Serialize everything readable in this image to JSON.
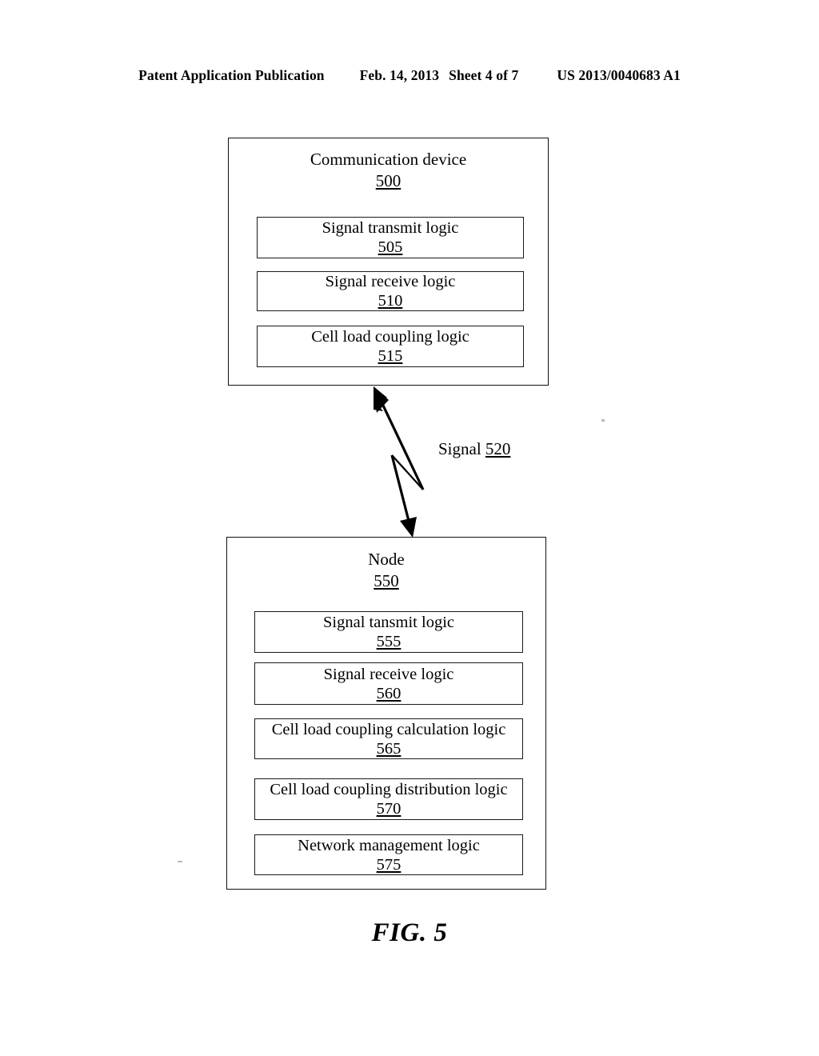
{
  "header": {
    "left": "Patent Application Publication",
    "date": "Feb. 14, 2013",
    "sheet": "Sheet 4 of 7",
    "publication_number": "US 2013/0040683 A1"
  },
  "figure": {
    "caption": "FIG. 5",
    "signal": {
      "label": "Signal",
      "ref": "520"
    },
    "blocks": [
      {
        "title": "Communication device",
        "ref": "500",
        "components": [
          {
            "label": "Signal transmit logic",
            "ref": "505"
          },
          {
            "label": "Signal receive logic",
            "ref": "510"
          },
          {
            "label": "Cell load coupling logic",
            "ref": "515"
          }
        ]
      },
      {
        "title": "Node",
        "ref": "550",
        "components": [
          {
            "label": "Signal tansmit logic",
            "ref": "555"
          },
          {
            "label": "Signal receive logic",
            "ref": "560"
          },
          {
            "label": "Cell load coupling calculation logic",
            "ref": "565"
          },
          {
            "label": "Cell load coupling distribution logic",
            "ref": "570"
          },
          {
            "label": "Network management logic",
            "ref": "575"
          }
        ]
      }
    ]
  }
}
